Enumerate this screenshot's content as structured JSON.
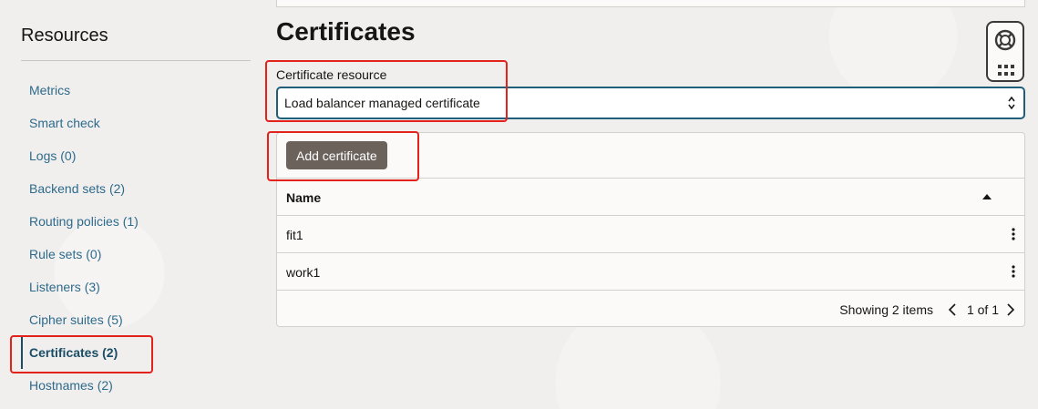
{
  "sidebar": {
    "title": "Resources",
    "items": [
      {
        "label": "Metrics"
      },
      {
        "label": "Smart check"
      },
      {
        "label": "Logs (0)"
      },
      {
        "label": "Backend sets (2)"
      },
      {
        "label": "Routing policies (1)"
      },
      {
        "label": "Rule sets (0)"
      },
      {
        "label": "Listeners (3)"
      },
      {
        "label": "Cipher suites (5)"
      },
      {
        "label": "Certificates (2)",
        "active": true
      },
      {
        "label": "Hostnames (2)"
      }
    ]
  },
  "main": {
    "title": "Certificates",
    "field_label": "Certificate resource",
    "select_value": "Load balancer managed certificate",
    "add_button": "Add certificate",
    "table": {
      "column_name": "Name",
      "rows": [
        {
          "name": "fit1"
        },
        {
          "name": "work1"
        }
      ],
      "footer_count": "Showing 2 items",
      "footer_pages": "1 of 1"
    }
  },
  "icons": {
    "help": "lifebuoy-icon",
    "apps": "grid-icon",
    "sort": "sort-ascending-icon",
    "row_actions": "kebab-icon",
    "select": "chevron-up-down-icon",
    "prev": "chevron-left-icon",
    "next": "chevron-right-icon"
  },
  "colors": {
    "link": "#2d6a8c",
    "active": "#1a4d66",
    "button": "#6b625c",
    "highlight": "#e3221b"
  }
}
